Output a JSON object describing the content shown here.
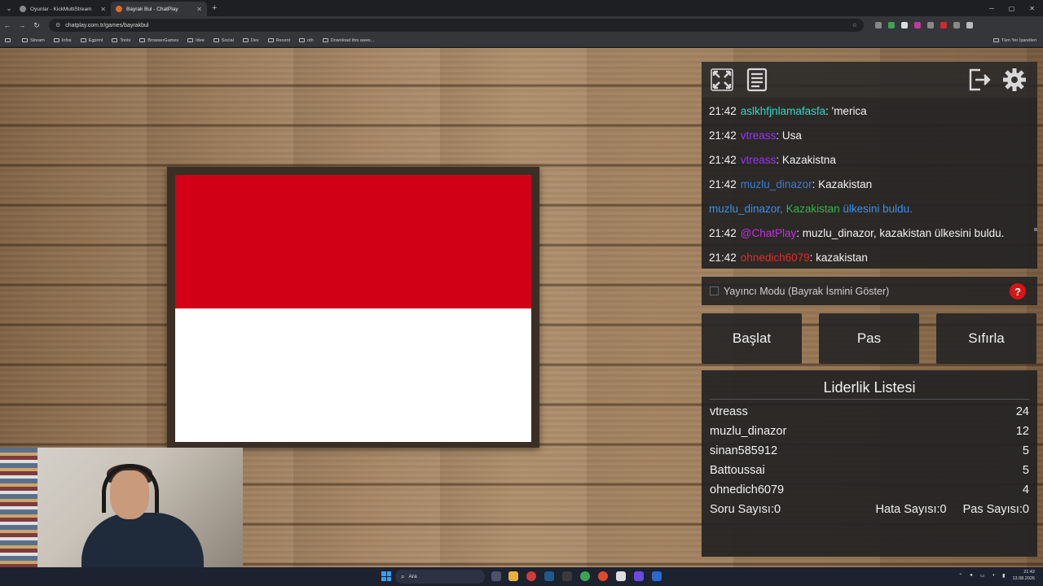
{
  "browser": {
    "tabs": [
      {
        "title": "Oyunlar - KickMultiStream",
        "active": false
      },
      {
        "title": "Bayrak Bul - ChatPlay",
        "active": true
      }
    ],
    "url": "chatplay.com.tr/games/bayrakbul",
    "bookmarks": [
      "Stream",
      "Infos",
      "Egprmt",
      "Tools",
      "BrowserGames",
      "Idee",
      "Social",
      "Dev",
      "Recent",
      "oth",
      "Download this awes..."
    ],
    "bookmarks_right": "Tüm Yer İşaretleri"
  },
  "colors": {
    "flag_top": "#d10016",
    "flag_bottom": "#ffffff",
    "user_teal": "#36d6c9",
    "user_purple": "#9b30ff",
    "user_blue": "#3a7bd5",
    "user_red": "#e22a2a",
    "user_green": "#32b34a",
    "user_magenta": "#c030e0",
    "system_blue": "#3a8fe8"
  },
  "chat": [
    {
      "time": "21:42",
      "user": "aslkhfjnlamafasfa",
      "user_color": "#36d6c9",
      "message": ": 'merica"
    },
    {
      "time": "21:42",
      "user": "vtreass",
      "user_color": "#9b30ff",
      "message": ": Usa"
    },
    {
      "time": "21:42",
      "user": "vtreass",
      "user_color": "#9b30ff",
      "message": ": Kazakistna"
    },
    {
      "time": "21:42",
      "user": "muzlu_dinazor",
      "user_color": "#3a7bd5",
      "message": ": Kazakistan"
    },
    {
      "system": true,
      "user": "muzlu_dinazor,",
      "country": "Kazakistan",
      "suffix": "ülkesini buldu."
    },
    {
      "time": "21:42",
      "user": "@ChatPlay",
      "user_color": "#c030e0",
      "message": ": muzlu_dinazor, kazakistan ülkesini buldu."
    },
    {
      "time": "21:42",
      "user": "ohnedich6079",
      "user_color": "#e22a2a",
      "message": ": kazakistan"
    }
  ],
  "mode": {
    "label": "Yayıncı Modu (Bayrak İsmini Göster)",
    "help": "?"
  },
  "buttons": {
    "start": "Başlat",
    "pass": "Pas",
    "reset": "Sıfırla"
  },
  "leaderboard": {
    "title": "Liderlik Listesi",
    "rows": [
      {
        "name": "vtreass",
        "score": "24"
      },
      {
        "name": "muzlu_dinazor",
        "score": "12"
      },
      {
        "name": "sinan585912",
        "score": "5"
      },
      {
        "name": "Battoussai",
        "score": "5"
      },
      {
        "name": "ohnedich6079",
        "score": "4"
      }
    ],
    "question_count": "Soru Sayısı:0",
    "error_count": "Hata Sayısı:0",
    "pass_count": "Pas Sayısı:0"
  },
  "taskbar": {
    "search_placeholder": "Ara",
    "time": "21:42",
    "date": "13.08.2026"
  }
}
